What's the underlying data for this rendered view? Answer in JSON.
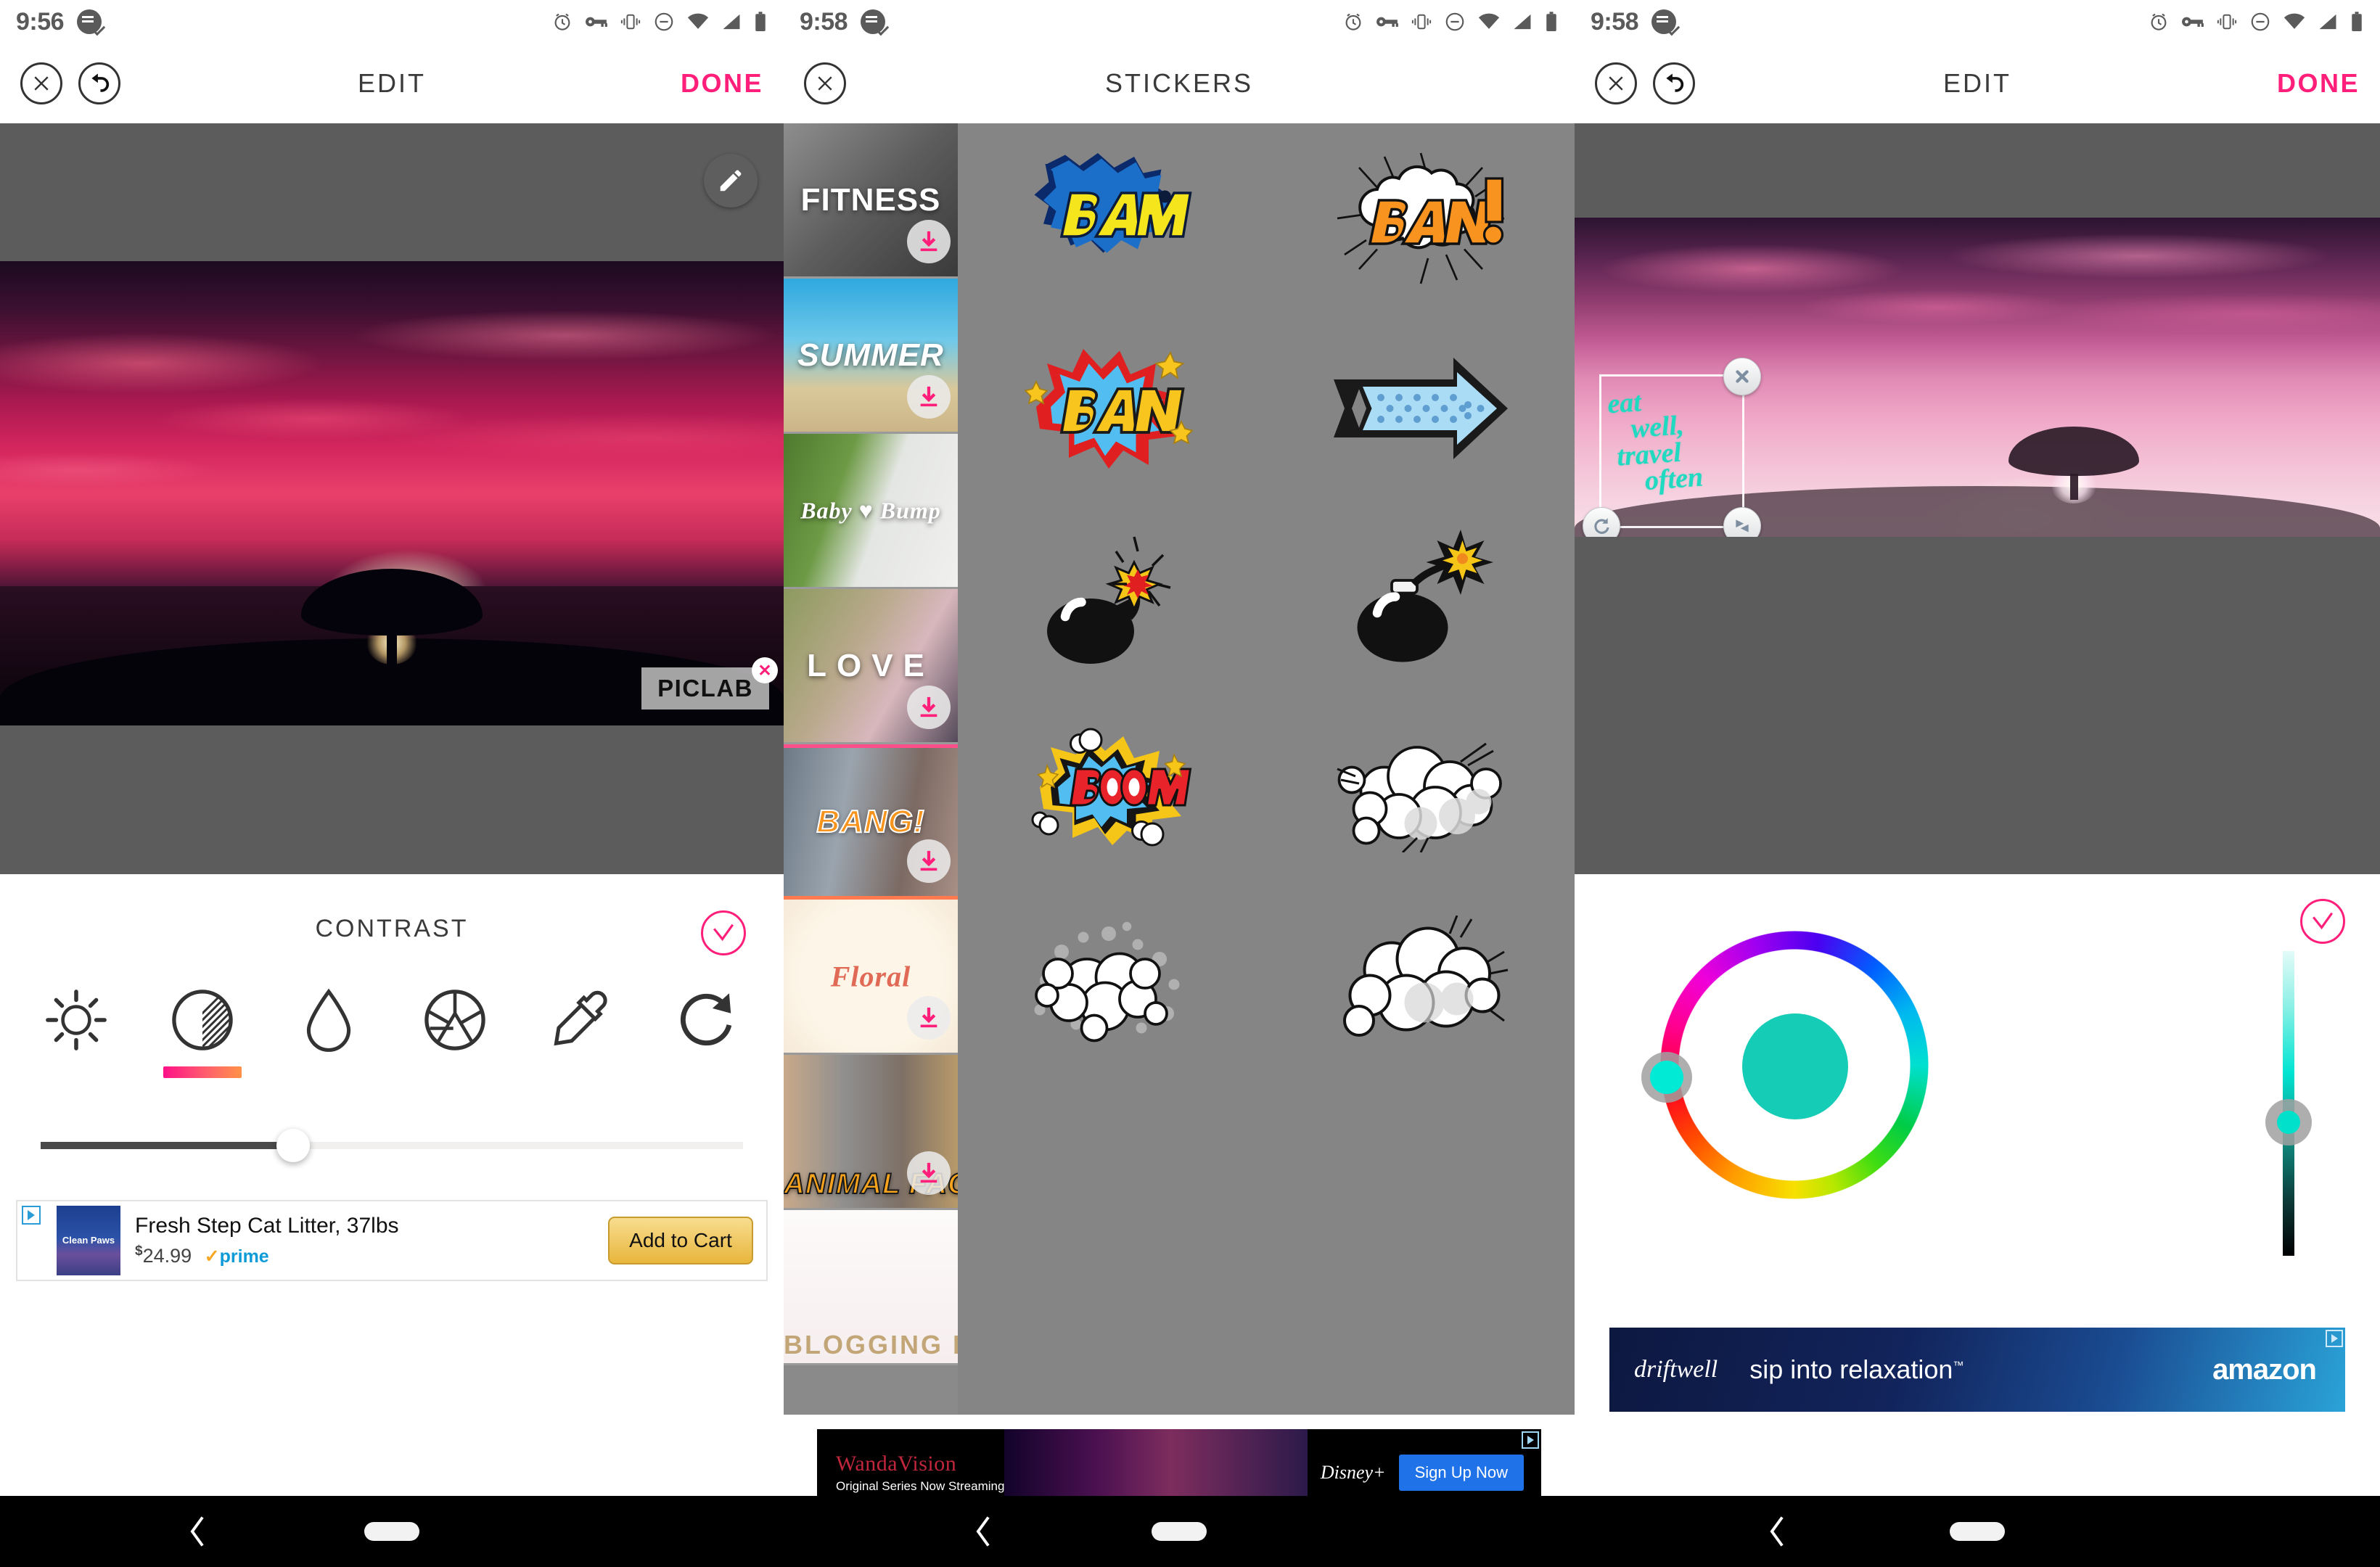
{
  "app": {
    "name": "PicLab",
    "accent_pink": "#ff1f7a",
    "accent_teal": "#15ccb6"
  },
  "screens": [
    {
      "id": "edit-contrast",
      "status": {
        "time": "9:56",
        "icons": [
          "alarm-icon",
          "vpn-key-icon",
          "vibrate-icon",
          "do-not-disturb-icon",
          "wifi-icon",
          "signal-icon",
          "battery-icon"
        ]
      },
      "toolbar": {
        "close_label": "✕",
        "undo_label": "undo",
        "title": "EDIT",
        "done_label": "DONE"
      },
      "canvas": {
        "edit_icon": "pencil-icon",
        "watermark": "PICLAB",
        "watermark_close": "✕"
      },
      "adjust": {
        "title": "CONTRAST",
        "confirm_icon": "check-icon",
        "tools": [
          {
            "name": "brightness",
            "icon": "sun-icon",
            "active": false
          },
          {
            "name": "contrast",
            "icon": "contrast-icon",
            "active": true
          },
          {
            "name": "saturation",
            "icon": "droplet-icon",
            "active": false
          },
          {
            "name": "exposure",
            "icon": "aperture-icon",
            "active": false
          },
          {
            "name": "color-picker",
            "icon": "eyedropper-icon",
            "active": false
          },
          {
            "name": "rotate",
            "icon": "rotate-icon",
            "active": false
          }
        ],
        "slider_percent": 36
      },
      "ad": {
        "tag": "ad-choices-icon",
        "product_brand": "Clean Paws",
        "title": "Fresh Step Cat Litter, 37lbs",
        "currency": "$",
        "price": "24.99",
        "prime_label": "prime",
        "cta": "Add to Cart"
      }
    },
    {
      "id": "stickers",
      "status": {
        "time": "9:58",
        "icons": [
          "alarm-icon",
          "vpn-key-icon",
          "vibrate-icon",
          "do-not-disturb-icon",
          "wifi-icon",
          "signal-icon",
          "battery-icon"
        ]
      },
      "toolbar": {
        "close_label": "✕",
        "title": "STICKERS"
      },
      "packs": [
        {
          "label": "FITNESS",
          "download": true
        },
        {
          "label": "SUMMER",
          "download": true
        },
        {
          "label": "Baby ♥ Bump",
          "download": false
        },
        {
          "label": "LOVE",
          "download": true
        },
        {
          "label": "BANG!",
          "download": true
        },
        {
          "label": "Floral",
          "download": true
        },
        {
          "label": "ANIMAL FACES",
          "download": true
        },
        {
          "label": "BLOGGING KIT",
          "download": false
        }
      ],
      "stickers": [
        {
          "name": "bam-sticker",
          "label": "BAM"
        },
        {
          "name": "bang-cloud-sticker",
          "label": "BANG!"
        },
        {
          "name": "bang-burst-sticker",
          "label": "BANG"
        },
        {
          "name": "arrow-sticker",
          "label": ""
        },
        {
          "name": "bomb-lit-sticker",
          "label": ""
        },
        {
          "name": "bomb-spark-sticker",
          "label": ""
        },
        {
          "name": "boom-sticker",
          "label": "BOOM!!"
        },
        {
          "name": "smoke-cloud-sticker",
          "label": ""
        },
        {
          "name": "puff-cloud-sticker",
          "label": ""
        },
        {
          "name": "cloud-sticker",
          "label": ""
        }
      ],
      "ad": {
        "tag": "ad-choices-icon",
        "brand": "WandaVision",
        "subtitle": "Original Series Now Streaming",
        "sponsor": "Disney+",
        "cta": "Sign Up Now"
      }
    },
    {
      "id": "edit-color",
      "status": {
        "time": "9:58",
        "icons": [
          "alarm-icon",
          "vpn-key-icon",
          "vibrate-icon",
          "do-not-disturb-icon",
          "wifi-icon",
          "signal-icon",
          "battery-icon"
        ]
      },
      "toolbar": {
        "close_label": "✕",
        "undo_label": "undo",
        "title": "EDIT",
        "done_label": "DONE"
      },
      "sticker": {
        "text_lines": [
          "eat",
          "well,",
          "travel",
          "often"
        ],
        "color": "#1fd9c0",
        "handles": [
          {
            "name": "delete-handle",
            "icon": "close-icon"
          },
          {
            "name": "rotate-handle",
            "icon": "rotate-icon"
          },
          {
            "name": "resize-handle",
            "icon": "resize-icon"
          }
        ]
      },
      "color_picker": {
        "confirm_icon": "check-icon",
        "selected_color": "#15ccb6",
        "hue_knob_color": "#00ead6",
        "brightness_knob_color": "#00e0cb"
      },
      "ad": {
        "tag": "ad-choices-icon",
        "brand": "driftwell",
        "tagline": "sip into relaxation",
        "tm": "™",
        "sponsor": "amazon"
      }
    }
  ],
  "navbar": {
    "back_icon": "back-chevron-icon",
    "home_icon": "home-pill-icon"
  }
}
